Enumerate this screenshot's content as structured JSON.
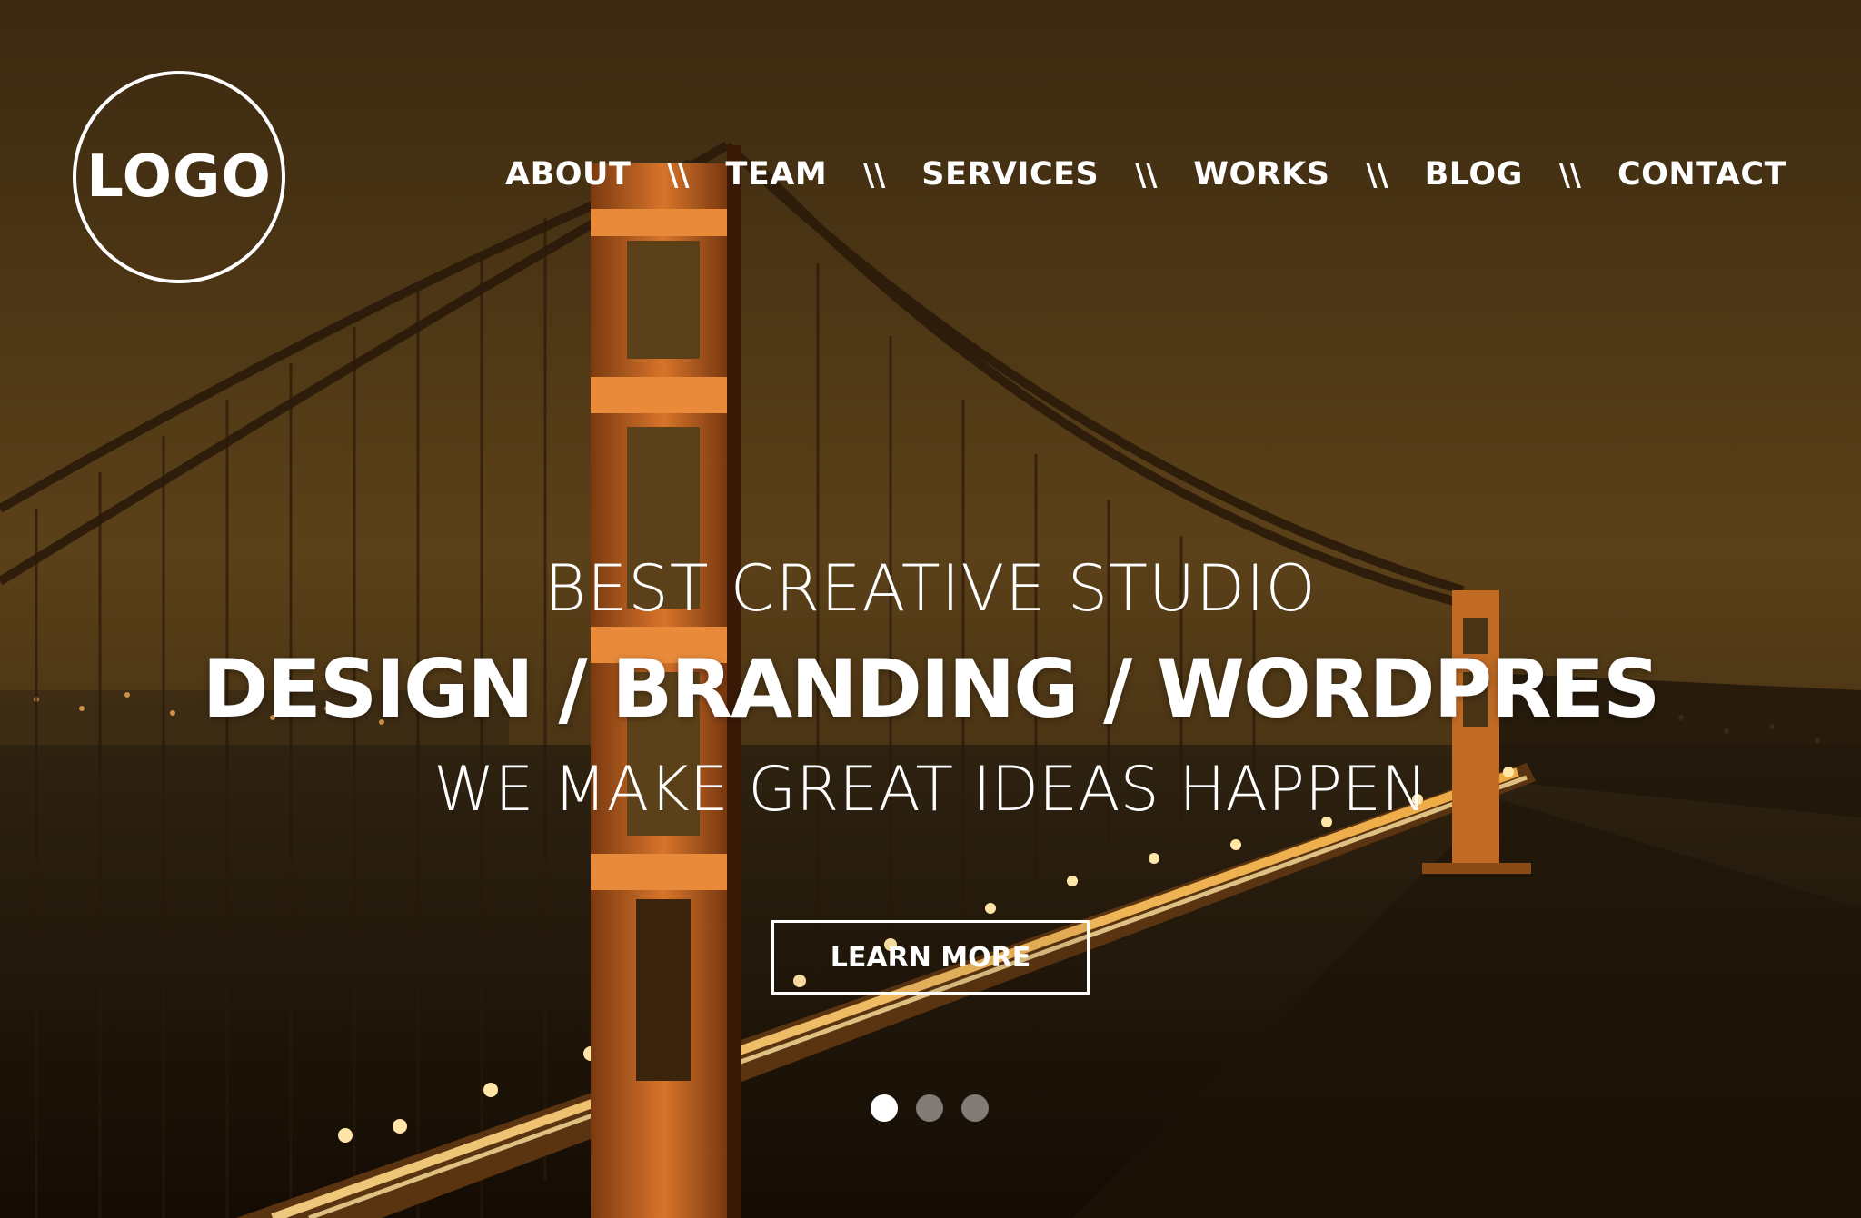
{
  "logo": {
    "text": "LOGO"
  },
  "nav": {
    "separator": "\\\\",
    "items": [
      {
        "label": "ABOUT"
      },
      {
        "label": "TEAM"
      },
      {
        "label": "SERVICES"
      },
      {
        "label": "WORKS"
      },
      {
        "label": "BLOG"
      },
      {
        "label": "CONTACT"
      }
    ]
  },
  "hero": {
    "kicker": "BEST CREATIVE STUDIO",
    "title": "DESIGN / BRANDING / WORDPRES",
    "tagline": "WE MAKE GREAT IDEAS HAPPEN",
    "cta_label": "LEARN MORE",
    "background_icon": "golden-gate-bridge-night-photo"
  },
  "slider": {
    "count": 3,
    "active_index": 0
  },
  "colors": {
    "text": "#ffffff",
    "sky": "#4a3213",
    "bridge": "#c8641a",
    "lights": "#ffc75a"
  }
}
